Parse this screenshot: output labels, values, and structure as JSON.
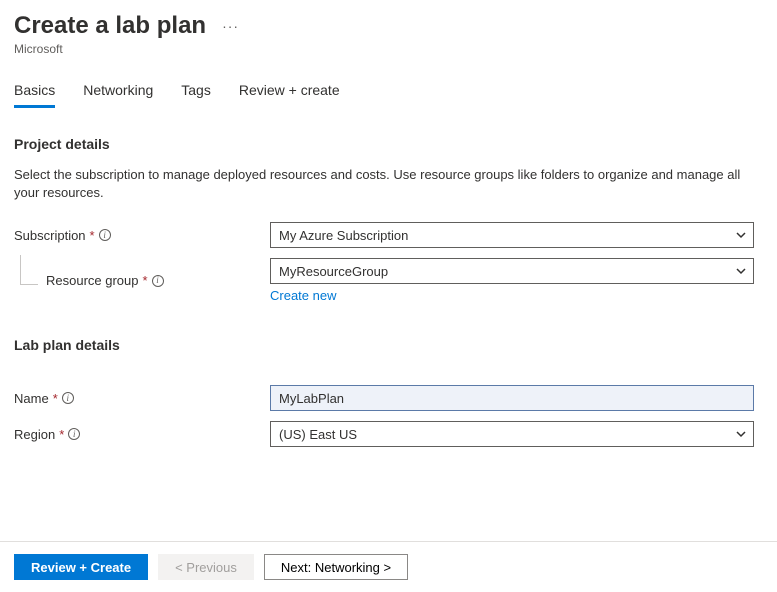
{
  "header": {
    "title": "Create a lab plan",
    "subtitle": "Microsoft",
    "more_label": "···"
  },
  "tabs": {
    "basics": "Basics",
    "networking": "Networking",
    "tags": "Tags",
    "review": "Review + create",
    "active": "basics"
  },
  "sections": {
    "project": {
      "heading": "Project details",
      "description": "Select the subscription to manage deployed resources and costs. Use resource groups like folders to organize and manage all your resources."
    },
    "labplan": {
      "heading": "Lab plan details"
    }
  },
  "fields": {
    "subscription": {
      "label": "Subscription",
      "value": "My Azure Subscription"
    },
    "resource_group": {
      "label": "Resource group",
      "value": "MyResourceGroup",
      "create_new": "Create new"
    },
    "name": {
      "label": "Name",
      "value": "MyLabPlan"
    },
    "region": {
      "label": "Region",
      "value": "(US) East US"
    }
  },
  "footer": {
    "review_create": "Review + Create",
    "previous": "< Previous",
    "next": "Next: Networking >"
  },
  "glyphs": {
    "required": "*",
    "info": "i"
  }
}
